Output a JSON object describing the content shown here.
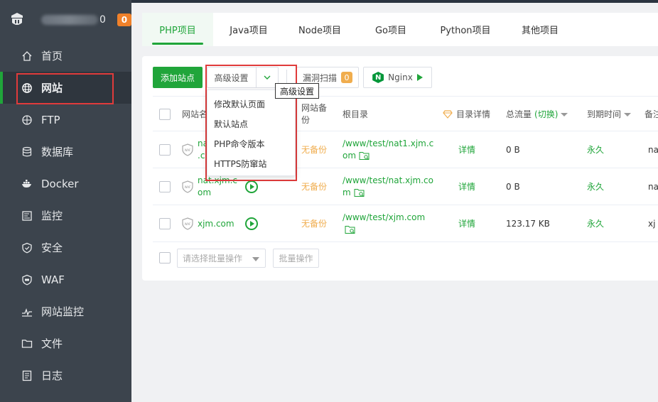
{
  "brand": {
    "suffix": "0",
    "badge": "0"
  },
  "sidebar": {
    "items": [
      {
        "label": "首页",
        "icon": "home-icon"
      },
      {
        "label": "网站",
        "icon": "globe-icon"
      },
      {
        "label": "FTP",
        "icon": "ftp-icon"
      },
      {
        "label": "数据库",
        "icon": "database-icon"
      },
      {
        "label": "Docker",
        "icon": "docker-icon"
      },
      {
        "label": "监控",
        "icon": "monitor-icon"
      },
      {
        "label": "安全",
        "icon": "shield-icon"
      },
      {
        "label": "WAF",
        "icon": "waf-icon"
      },
      {
        "label": "网站监控",
        "icon": "chart-icon"
      },
      {
        "label": "文件",
        "icon": "folder-icon"
      },
      {
        "label": "日志",
        "icon": "log-icon"
      }
    ],
    "active": "网站"
  },
  "tabs": [
    "PHP项目",
    "Java项目",
    "Node项目",
    "Go项目",
    "Python项目",
    "其他项目"
  ],
  "toolbar": {
    "add_site": "添加站点",
    "advanced": "高级设置",
    "vuln_scan": "漏洞扫描",
    "vuln_count": "0",
    "nginx": "Nginx"
  },
  "dropdown": {
    "options": [
      "修改默认页面",
      "默认站点",
      "PHP命令版本",
      "HTTPS防窜站"
    ]
  },
  "tooltip": "高级设置",
  "table": {
    "headers": {
      "name": "网站名",
      "backup_line1": "网站备",
      "backup_line2": "份",
      "root": "根目录",
      "dir_detail": "目录详情",
      "traffic": "总流量",
      "traffic_switch": "(切换)",
      "expiry": "到期时间",
      "remark": "备注"
    },
    "rows": [
      {
        "name_l1": "na",
        "name_l2": ".c",
        "backup": "无备份",
        "root_l1": "/www/test/nat1.xjm.c",
        "root_l2": "om",
        "detail": "详情",
        "traffic": "0 B",
        "expiry": "永久",
        "remark": "na"
      },
      {
        "name_l1": "nat.xjm.c",
        "name_l2": "om",
        "backup": "无备份",
        "root_l1": "/www/test/nat.xjm.co",
        "root_l2": "m",
        "detail": "详情",
        "traffic": "0 B",
        "expiry": "永久",
        "remark": "na"
      },
      {
        "name_l1": "xjm.com",
        "name_l2": "",
        "backup": "无备份",
        "root_l1": "/www/test/xjm.com",
        "root_l2": "",
        "detail": "详情",
        "traffic": "123.17 KB",
        "expiry": "永久",
        "remark": "xj"
      }
    ]
  },
  "bulk": {
    "placeholder": "请选择批量操作",
    "button": "批量操作"
  },
  "colors": {
    "accent": "#20a53a",
    "sidebar": "#3c444d",
    "highlight": "#e03b3b",
    "warning": "#f0ad4e"
  }
}
